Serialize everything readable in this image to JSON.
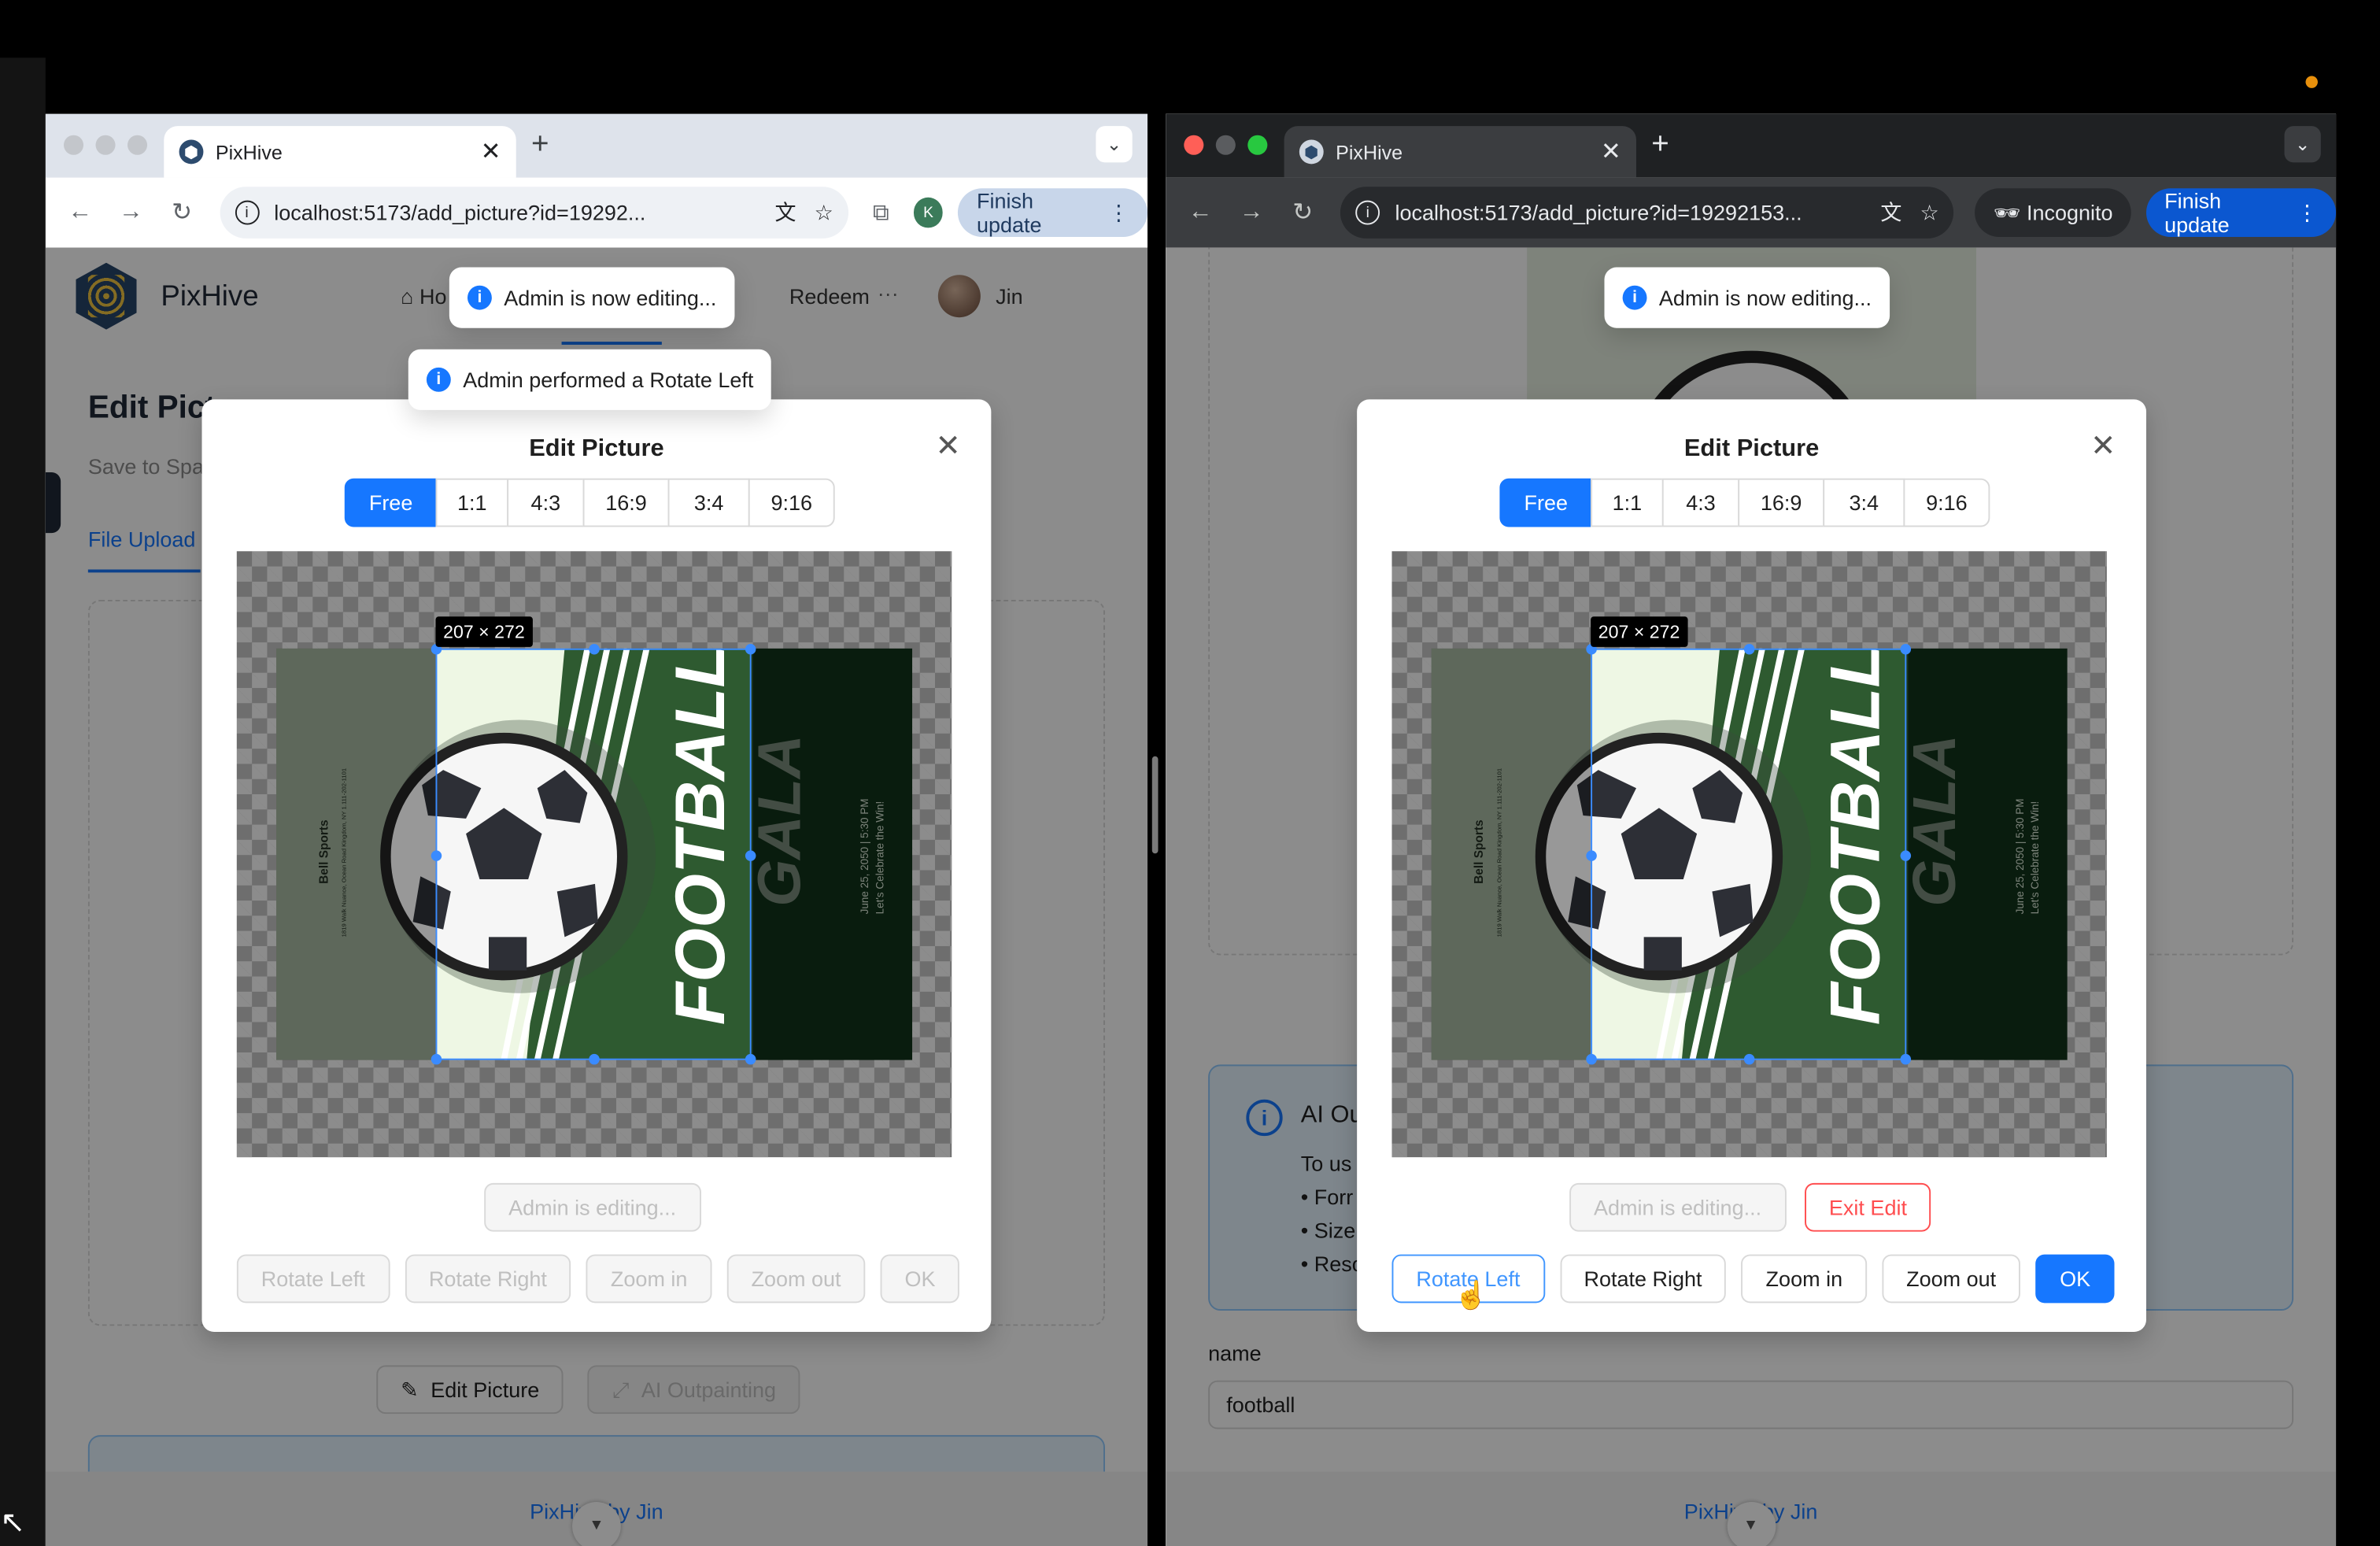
{
  "system": {
    "accent_dot_color": "#e8900c"
  },
  "left": {
    "tab_title": "PixHive",
    "url": "localhost:5173/add_picture?id=19292...",
    "profile_letter": "K",
    "finish_update": "Finish update",
    "app": {
      "brand": "PixHive",
      "nav_home": "Ho",
      "nav_redeem": "Redeem",
      "nav_more": "···",
      "user_name": "Jin",
      "page_title": "Edit Pict",
      "page_subtitle": "Save to Spa",
      "tab_upload": "File Upload",
      "edit_picture_button": "Edit Picture",
      "ai_outpainting_button": "AI Outpainting",
      "footer": "PixHive by Jin"
    },
    "toasts": [
      "Admin is now editing...",
      "Admin performed a Rotate Left"
    ],
    "modal": {
      "title": "Edit Picture",
      "ratios": [
        "Free",
        "1:1",
        "4:3",
        "16:9",
        "3:4",
        "9:16"
      ],
      "selected_ratio": "Free",
      "crop_size": "207 × 272",
      "editing_status": "Admin is editing...",
      "actions": [
        "Rotate Left",
        "Rotate Right",
        "Zoom in",
        "Zoom out",
        "OK"
      ]
    }
  },
  "right": {
    "tab_title": "PixHive",
    "url": "localhost:5173/add_picture?id=19292153...",
    "incognito": "Incognito",
    "finish_update": "Finish update",
    "app": {
      "ai_card_title": "AI Ou",
      "ai_card_lines": [
        "To us",
        "• Forr",
        "• Size",
        "• Reso"
      ],
      "name_label": "name",
      "name_value": "football",
      "footer": "PixHive by Jin"
    },
    "toasts": [
      "Admin is now editing..."
    ],
    "modal": {
      "title": "Edit Picture",
      "ratios": [
        "Free",
        "1:1",
        "4:3",
        "16:9",
        "3:4",
        "9:16"
      ],
      "selected_ratio": "Free",
      "crop_size": "207 × 272",
      "editing_status": "Admin is editing...",
      "exit_edit": "Exit Edit",
      "actions": [
        "Rotate Left",
        "Rotate Right",
        "Zoom in",
        "Zoom out",
        "OK"
      ]
    }
  },
  "poster": {
    "venue": "Bell Sports",
    "address": "1819 Walk Nuance, Ocean Road Kingdom, NY 1.111-202-1101",
    "headline_1": "FOOTBALL",
    "headline_2": "GALA",
    "date_line": "June 25, 2050 | 5:30 PM",
    "tagline": "Let's Celebrate the Win!",
    "colors": {
      "dark_green": "#0f2e17",
      "mid_green": "#2e5a30",
      "sage": "#98a893",
      "pale": "#eef7e4"
    }
  }
}
